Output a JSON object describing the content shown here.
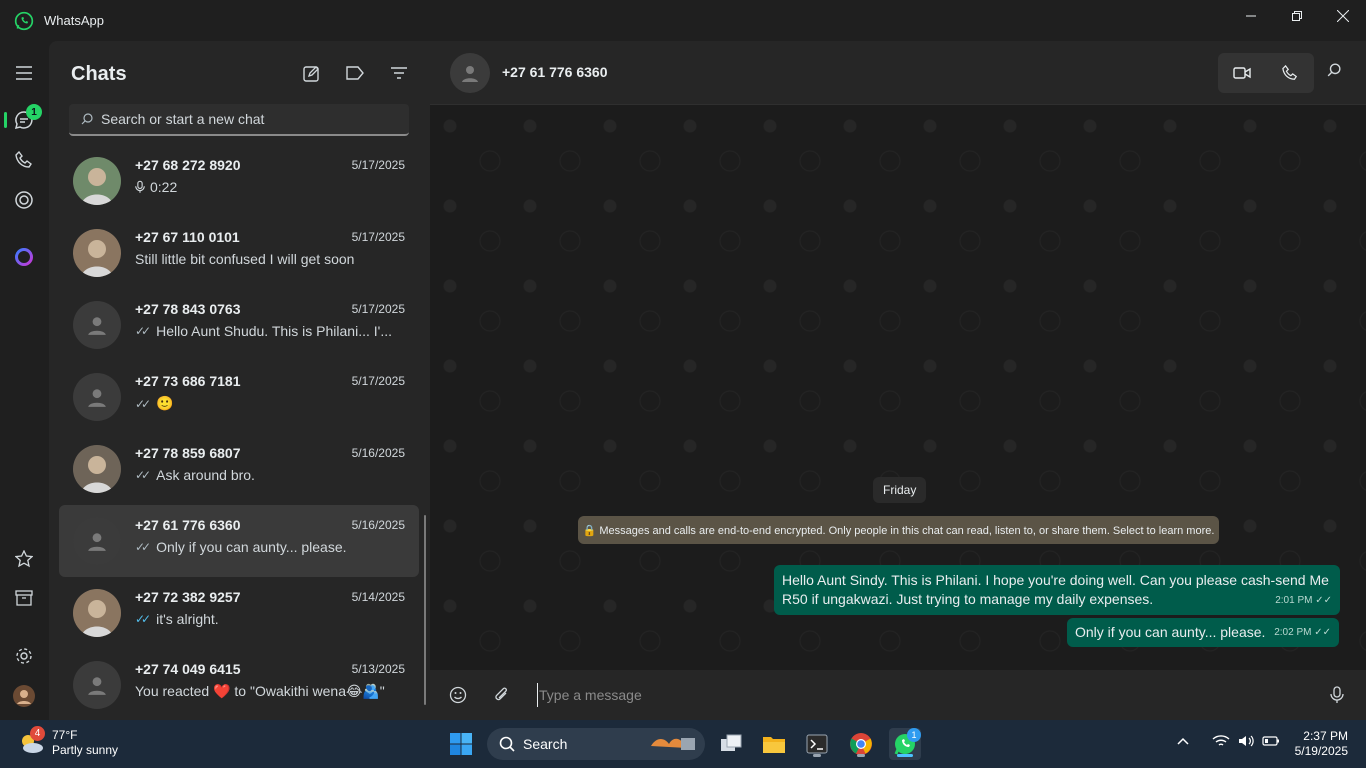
{
  "window": {
    "title": "WhatsApp"
  },
  "rail": {
    "chats_badge": "1"
  },
  "chatlist": {
    "title": "Chats",
    "search_placeholder": "Search or start a new chat",
    "items": [
      {
        "name": "+27 68 272 8920",
        "date": "5/17/2025",
        "preview": "0:22",
        "prefix": "mic",
        "avatar": "photo"
      },
      {
        "name": "+27 67 110 0101",
        "date": "5/17/2025",
        "preview": "Still little bit confused I will get soon",
        "prefix": "",
        "avatar": "photo"
      },
      {
        "name": "+27 78 843 0763",
        "date": "5/17/2025",
        "preview": "Hello Aunt Shudu. This is Philani... I'...",
        "prefix": "ticks",
        "avatar": "default"
      },
      {
        "name": "+27 73 686 7181",
        "date": "5/17/2025",
        "preview": "🙂",
        "prefix": "ticks",
        "avatar": "default"
      },
      {
        "name": "+27 78 859 6807",
        "date": "5/16/2025",
        "preview": "Ask around bro.",
        "prefix": "ticks",
        "avatar": "photo"
      },
      {
        "name": "+27 61 776 6360",
        "date": "5/16/2025",
        "preview": "Only if you can aunty... please.",
        "prefix": "ticks",
        "avatar": "default",
        "active": true
      },
      {
        "name": "+27 72 382 9257",
        "date": "5/14/2025",
        "preview": "it's alright.",
        "prefix": "ticks-blue",
        "avatar": "photo"
      },
      {
        "name": "+27 74 049 6415",
        "date": "5/13/2025",
        "preview": "You reacted ❤️ to \"Owakithi wena😂🫂\"",
        "prefix": "",
        "avatar": "default"
      }
    ]
  },
  "conversation": {
    "contact": "+27 61 776 6360",
    "day_label": "Friday",
    "encryption_notice": "🔒 Messages and calls are end-to-end encrypted. Only people in this chat can read, listen to, or share them. Select to learn more.",
    "messages": [
      {
        "text": "Hello Aunt Sindy. This is Philani. I hope you're doing well. Can you please cash-send Me R50 if ungakwazi. Just trying to manage my daily expenses.",
        "time": "2:01 PM"
      },
      {
        "text": "Only if you can aunty... please.",
        "time": "2:02 PM"
      }
    ],
    "composer_placeholder": "Type a message"
  },
  "taskbar": {
    "weather_temp": "77°F",
    "weather_desc": "Partly sunny",
    "weather_badge": "4",
    "search_label": "Search",
    "whatsapp_badge": "1",
    "time": "2:37 PM",
    "date": "5/19/2025"
  },
  "colors": {
    "accent": "#25d366",
    "bubble_out": "#005c4b",
    "panel": "#262626",
    "background": "#1f1f1f"
  }
}
